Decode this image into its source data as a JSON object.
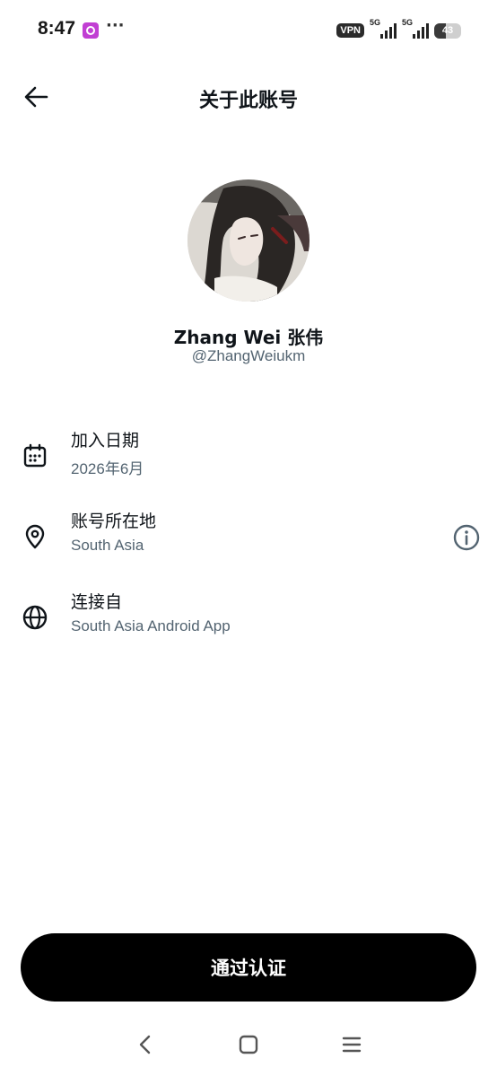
{
  "status_bar": {
    "time": "8:47",
    "overflow": "···",
    "vpn": "VPN",
    "sim1_network": "5G",
    "sim2_network": "5G",
    "battery_level": "43",
    "app_icon": "camera-app-icon"
  },
  "header": {
    "title": "关于此账号",
    "back_icon": "arrow-left-icon"
  },
  "profile": {
    "display_name": "Zhang Wei 张伟",
    "username": "@ZhangWeiukm"
  },
  "info": [
    {
      "label": "加入日期",
      "value": "2026年6月",
      "icon": "calendar-icon"
    },
    {
      "label": "账号所在地",
      "value": "South Asia",
      "icon": "location-pin-icon",
      "action_icon": "info-circle-icon"
    },
    {
      "label": "连接自",
      "value": "South Asia Android App",
      "icon": "globe-icon"
    }
  ],
  "verify_button": {
    "label": "通过认证"
  },
  "nav": {
    "back_icon": "chevron-left-icon",
    "home_icon": "square-icon",
    "recents_icon": "menu-lines-icon"
  },
  "colors": {
    "primary_text": "#0f1419",
    "secondary_text": "#536471",
    "button_bg": "#000000",
    "background": "#ffffff"
  }
}
